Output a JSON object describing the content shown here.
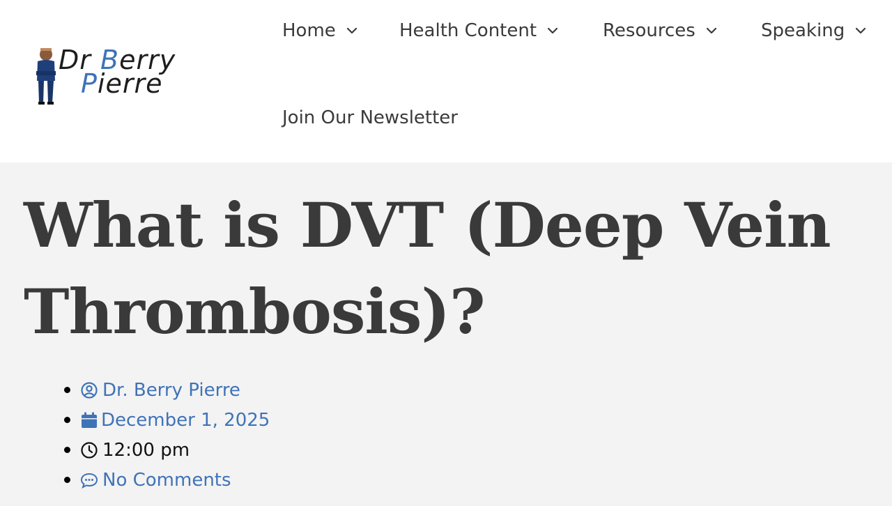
{
  "site": {
    "logo_line1_a": "Dr",
    "logo_line1_b": "B",
    "logo_line1_c": "erry",
    "logo_line2_a": "P",
    "logo_line2_b": "ierre"
  },
  "nav": {
    "items": [
      {
        "label": "Home",
        "has_dropdown": true
      },
      {
        "label": "Health Content",
        "has_dropdown": true
      },
      {
        "label": "Resources",
        "has_dropdown": true
      },
      {
        "label": "Speaking",
        "has_dropdown": true
      },
      {
        "label": "Join Our Newsletter",
        "has_dropdown": false
      }
    ]
  },
  "post": {
    "title": "What is DVT (Deep Vein Thrombosis)?",
    "meta": {
      "author": "Dr. Berry Pierre",
      "date": "December 1, 2025",
      "time": "12:00 pm",
      "comments": "No Comments"
    }
  },
  "colors": {
    "link": "#3f73b8",
    "text": "#3a3a3a",
    "page_bg": "#f3f3f3",
    "header_bg": "#ffffff"
  },
  "icons": {
    "author": "user-circle-icon",
    "date": "calendar-icon",
    "time": "clock-icon",
    "comments": "comment-dots-icon",
    "dropdown": "chevron-down-icon"
  }
}
